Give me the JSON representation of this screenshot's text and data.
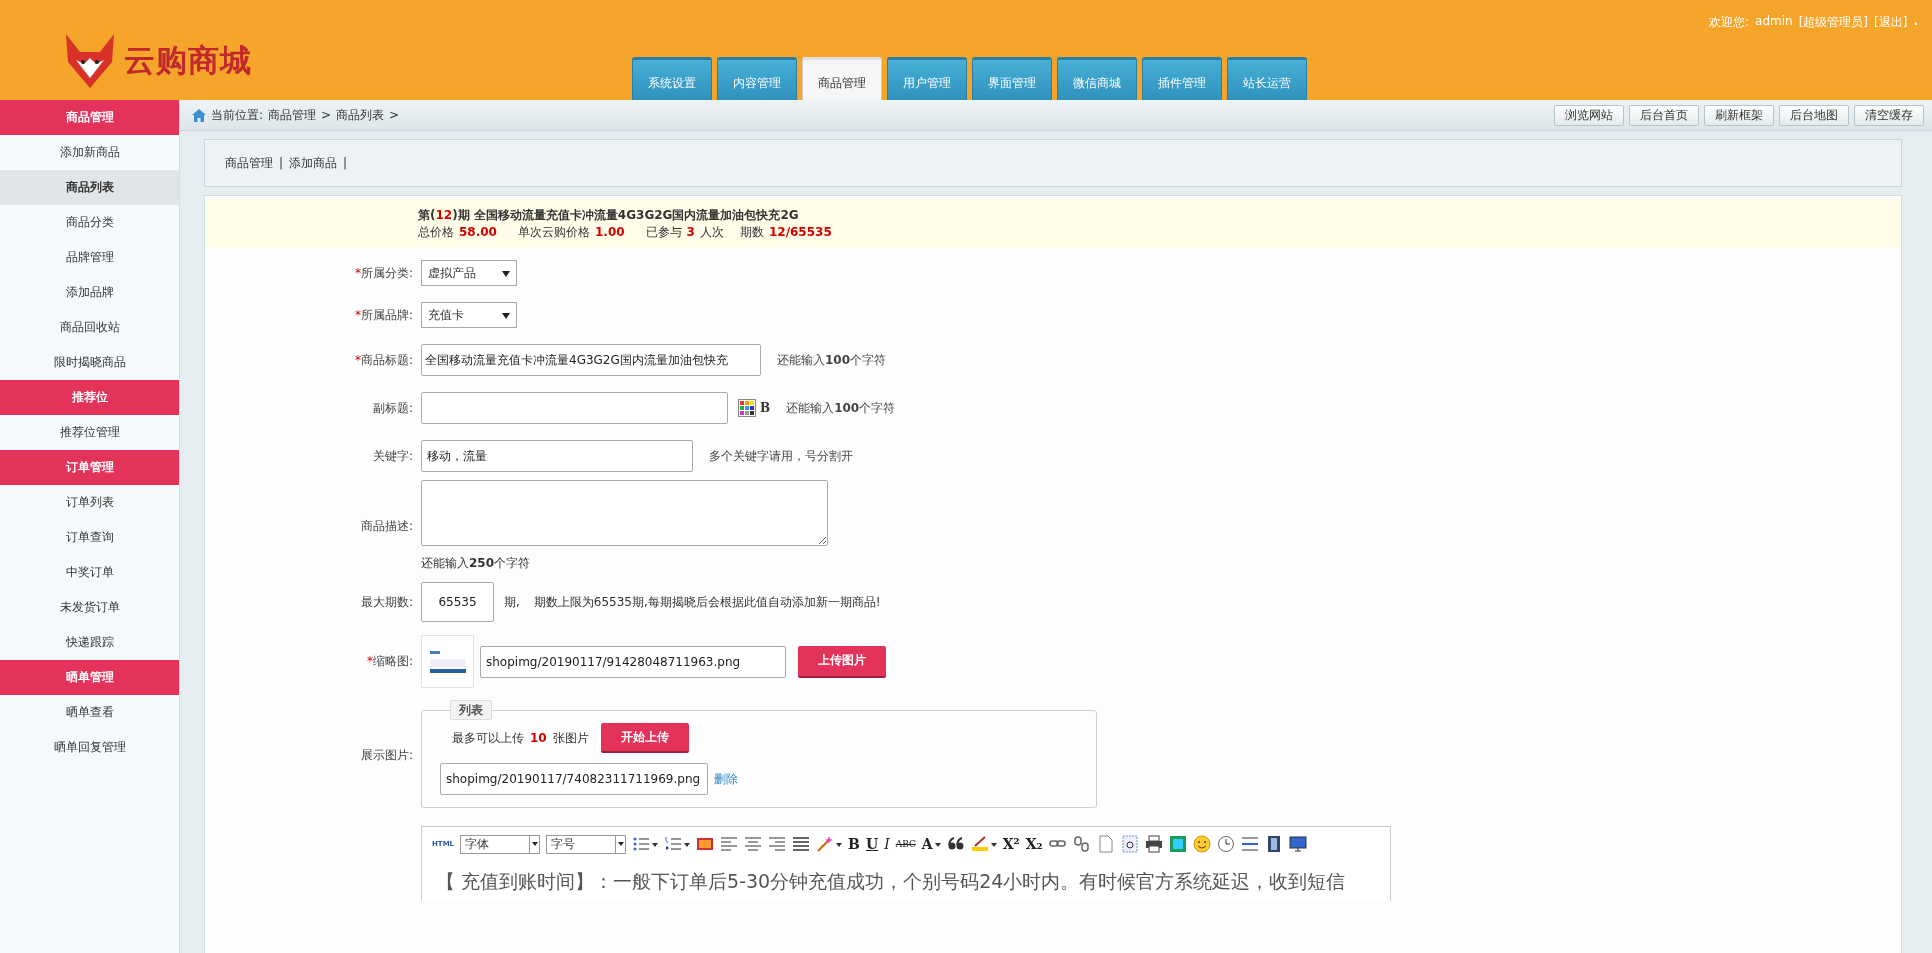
{
  "header": {
    "logo_text": "云购商城",
    "welcome": "欢迎您:",
    "user": "admin",
    "role": "[超级管理员]",
    "logout": "[退出]",
    "dot": "."
  },
  "tabs": [
    {
      "label": "系统设置",
      "selected": false
    },
    {
      "label": "内容管理",
      "selected": false
    },
    {
      "label": "商品管理",
      "selected": true
    },
    {
      "label": "用户管理",
      "selected": false
    },
    {
      "label": "界面管理",
      "selected": false
    },
    {
      "label": "微信商城",
      "selected": false
    },
    {
      "label": "插件管理",
      "selected": false
    },
    {
      "label": "站长运营",
      "selected": false
    }
  ],
  "sidebar": {
    "groups": [
      {
        "title": "商品管理",
        "items": [
          {
            "label": "添加新商品",
            "selected": false
          },
          {
            "label": "商品列表",
            "selected": true
          },
          {
            "label": "商品分类",
            "selected": false
          },
          {
            "label": "品牌管理",
            "selected": false
          },
          {
            "label": "添加品牌",
            "selected": false
          },
          {
            "label": "商品回收站",
            "selected": false
          },
          {
            "label": "限时揭晓商品",
            "selected": false
          }
        ]
      },
      {
        "title": "推荐位",
        "items": [
          {
            "label": "推荐位管理",
            "selected": false
          }
        ]
      },
      {
        "title": "订单管理",
        "items": [
          {
            "label": "订单列表",
            "selected": false
          },
          {
            "label": "订单查询",
            "selected": false
          },
          {
            "label": "中奖订单",
            "selected": false
          },
          {
            "label": "未发货订单",
            "selected": false
          },
          {
            "label": "快递跟踪",
            "selected": false
          }
        ]
      },
      {
        "title": "晒单管理",
        "items": [
          {
            "label": "晒单查看",
            "selected": false
          },
          {
            "label": "晒单回复管理",
            "selected": false
          }
        ]
      }
    ]
  },
  "breadcrumb": {
    "prefix": "当前位置:",
    "items": [
      "商品管理",
      "商品列表"
    ],
    "separator": ">"
  },
  "top_buttons": [
    "浏览网站",
    "后台首页",
    "刷新框架",
    "后台地图",
    "清空缓存"
  ],
  "subnav": [
    {
      "label": "商品管理",
      "separator": "|"
    },
    {
      "label": "添加商品",
      "separator": "|"
    }
  ],
  "issue": {
    "prefix": "第(",
    "number": "12",
    "suffix": ")期",
    "title": "全国移动流量充值卡冲流量4G3G2G国内流量加油包快充2G",
    "stats": [
      {
        "label": "总价格",
        "value": "58.00"
      },
      {
        "label": "单次云购价格",
        "value": "1.00"
      },
      {
        "label": "已参与",
        "value": "3",
        "unit": "人次"
      },
      {
        "label": "期数",
        "value": "12/65535"
      }
    ]
  },
  "form": {
    "category": {
      "label": "所属分类:",
      "required_mark": "*",
      "value": "虚拟产品"
    },
    "brand": {
      "label": "所属品牌:",
      "required_mark": "*",
      "value": "充值卡"
    },
    "title": {
      "label": "商品标题:",
      "required_mark": "*",
      "value": "全国移动流量充值卡冲流量4G3G2G国内流量加油包快充",
      "hint": "还能输入**100**个字符"
    },
    "subtitle": {
      "label": "副标题:",
      "hint": "还能输入**100**个字符",
      "bold_button": "B"
    },
    "keywords": {
      "label": "关键字:",
      "value": "移动，流量",
      "hint": "多个关键字请用，号分割开"
    },
    "description": {
      "label": "商品描述:",
      "hint": "还能输入**250**个字符"
    },
    "max_periods": {
      "label": "最大期数:",
      "value": "65535",
      "unit": "期,",
      "hint": "期数上限为65535期,每期揭晓后会根据此值自动添加新一期商品!"
    },
    "thumbnail": {
      "label": "缩略图:",
      "required_mark": "*",
      "value": "shopimg/20190117/91428048711963.png",
      "button": "上传图片"
    },
    "gallery": {
      "label": "展示图片:",
      "legend": "列表",
      "limit_prefix": "最多可以上传",
      "limit": "10",
      "limit_suffix": "张图片",
      "button": "开始上传",
      "files": [
        {
          "path": "shopimg/20190117/74082311711969.png",
          "delete": "删除"
        }
      ]
    }
  },
  "editor": {
    "toolbar": [
      {
        "kind": "html",
        "label": "HTML"
      },
      {
        "kind": "select",
        "value": "字体"
      },
      {
        "kind": "select",
        "value": "字号"
      },
      {
        "kind": "bullets",
        "caret": true
      },
      {
        "kind": "numbers",
        "caret": true
      },
      {
        "kind": "image"
      },
      {
        "kind": "align-left"
      },
      {
        "kind": "align-center"
      },
      {
        "kind": "align-right"
      },
      {
        "kind": "justify"
      },
      {
        "kind": "wand",
        "caret": true
      },
      {
        "kind": "bold",
        "label": "B"
      },
      {
        "kind": "underline",
        "label": "U"
      },
      {
        "kind": "italic",
        "label": "I"
      },
      {
        "kind": "strike",
        "label": "ABC"
      },
      {
        "kind": "letter",
        "label": "A",
        "caret": true
      },
      {
        "kind": "quote"
      },
      {
        "kind": "highlight",
        "caret": true
      },
      {
        "kind": "letter",
        "label": "X²"
      },
      {
        "kind": "letter",
        "label": "X₂"
      },
      {
        "kind": "link"
      },
      {
        "kind": "unlink"
      },
      {
        "kind": "page"
      },
      {
        "kind": "anchor"
      },
      {
        "kind": "print"
      },
      {
        "kind": "picture"
      },
      {
        "kind": "smiley"
      },
      {
        "kind": "clock"
      },
      {
        "kind": "rule"
      },
      {
        "kind": "film"
      },
      {
        "kind": "monitor"
      }
    ],
    "content": "【 充值到账时间】：一般下订单后5-30分钟充值成功，个别号码24小时内。有时候官方系统延迟，收到短信"
  }
}
